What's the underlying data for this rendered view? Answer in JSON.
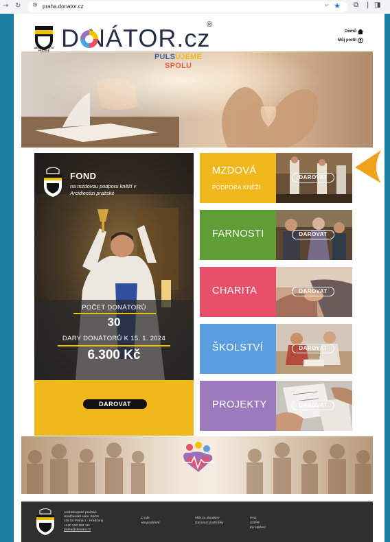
{
  "browser": {
    "url": "praha.donator.cz",
    "icons": [
      "back-icon",
      "reload-icon",
      "tune-icon",
      "zoom-icon",
      "star-icon",
      "extensions-icon",
      "sidepanel-icon"
    ]
  },
  "header": {
    "logo_text": "D  NÁTOR.cz",
    "logo_registered": "®",
    "crest_caption": "ARCIBISKUPSTVÍ PRAŽSKÉ",
    "links": [
      {
        "label": "Domů",
        "icon": "home-icon"
      },
      {
        "label": "Můj profil",
        "icon": "user-icon"
      }
    ]
  },
  "fond": {
    "title": "FOND",
    "subtitle": "na mzdovou podporu kněží v Arcidiecézi pražské",
    "donors_label": "POČET DONÁTORŮ",
    "donors_count": "30",
    "gifts_label": "DARY DONÁTORŮ K 15. 1. 2024",
    "gifts_amount": "6.300 Kč",
    "button_label": "DAROVAT"
  },
  "categories": [
    {
      "name": "MZDOVÁ",
      "sub": "PODPORA KNĚŽÍ",
      "button": "DAROVAT",
      "color": "#efb91d"
    },
    {
      "name": "FARNOSTI",
      "sub": "",
      "button": "DAROVAT",
      "color": "#5f9e35"
    },
    {
      "name": "CHARITA",
      "sub": "",
      "button": "DAROVAT",
      "color": "#e8506a"
    },
    {
      "name": "ŠKOLSTVÍ",
      "sub": "",
      "button": "DAROVAT",
      "color": "#5a9ee0"
    },
    {
      "name": "PROJEKTY",
      "sub": "",
      "button": "DAROVAT",
      "color": "#9b7bbd"
    }
  ],
  "banner": {
    "line1_a": "PULS",
    "line1_b": "UJEME",
    "line2": "SPOLU"
  },
  "footer": {
    "address": [
      "Arcibiskupství pražské",
      "Hradčanské nám. 56/16",
      "118 02 Praha 1 - Hradčany",
      "+420 220 392 111"
    ],
    "email": "praha@donator.cz",
    "col1": [
      "O nás",
      "Hospodaření"
    ],
    "col2": [
      "Míle za donátory",
      "Darovací podmínky"
    ],
    "col3": [
      "FAQ",
      "GDPR",
      "Ke stažení"
    ]
  },
  "colors": {
    "background": "#1a7fa2",
    "navy": "#262d49",
    "yellow": "#efb91d",
    "arrow": "#f0a21c"
  }
}
